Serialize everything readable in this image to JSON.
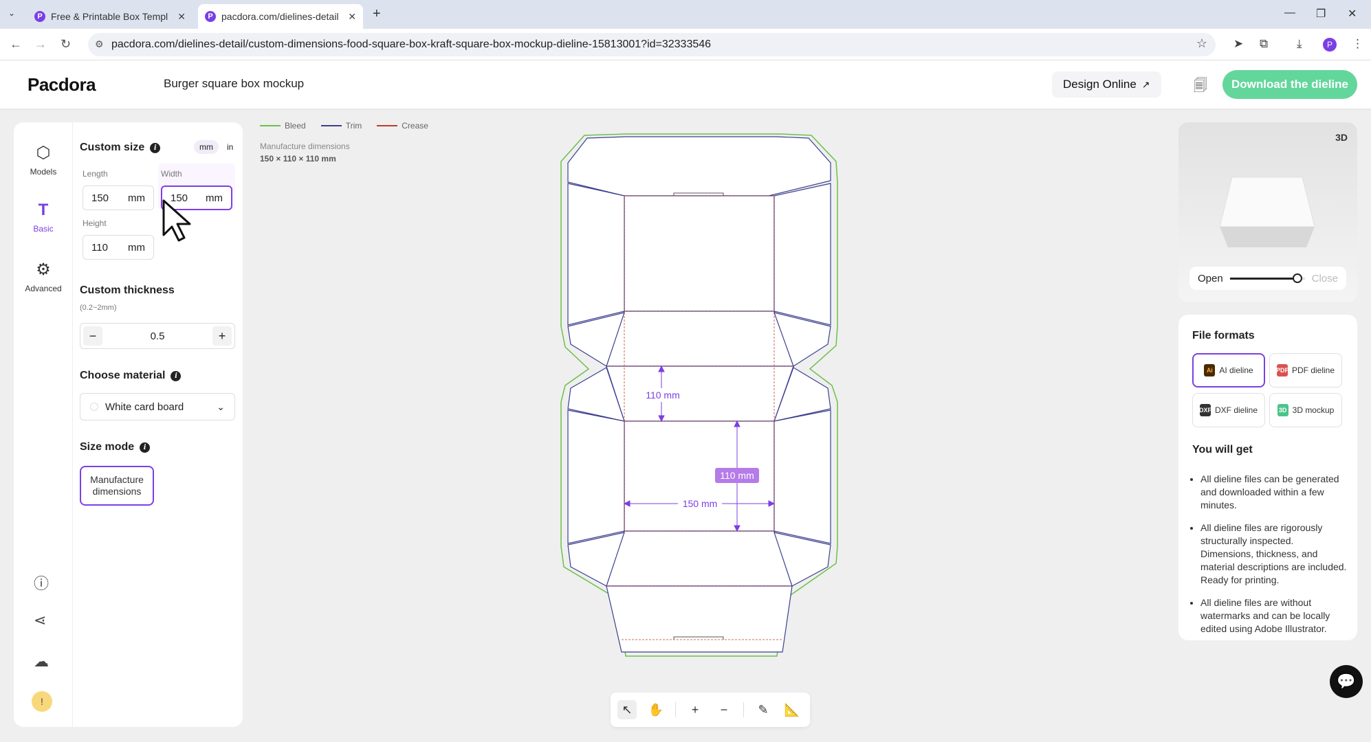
{
  "browser": {
    "tabs": [
      {
        "label": "Free & Printable Box Templat"
      },
      {
        "label": "pacdora.com/dielines-detail/"
      }
    ],
    "url": "paсdora.com/dielines-detail/custom-dimensions-food-square-box-kraft-square-box-mockup-dieline-15813001?id=32333546"
  },
  "header": {
    "logo": "Pacdora",
    "title": "Burger square box mockup",
    "design_online": "Design Online",
    "download": "Download the dieline"
  },
  "rail": {
    "items": [
      {
        "label": "Models",
        "icon": "cube-icon"
      },
      {
        "label": "Basic",
        "icon": "text-t-icon"
      },
      {
        "label": "Advanced",
        "icon": "sliders-icon"
      }
    ]
  },
  "custom_size": {
    "title": "Custom size",
    "units": [
      "mm",
      "in"
    ],
    "length_label": "Length",
    "length_value": "150",
    "width_label": "Width",
    "width_value": "150",
    "height_label": "Height",
    "height_value": "110",
    "unit": "mm"
  },
  "thickness": {
    "title": "Custom thickness",
    "range": "(0.2~2mm)",
    "value": "0.5",
    "minus": "−",
    "plus": "+"
  },
  "material": {
    "title": "Choose material",
    "value": "White card board"
  },
  "size_mode": {
    "title": "Size mode",
    "value": "Manufacture dimensions"
  },
  "legend": {
    "bleed": "Bleed",
    "trim": "Trim",
    "crease": "Crease",
    "colors": {
      "bleed": "#6cc04a",
      "trim": "#3b3f8f",
      "crease": "#c0392b"
    }
  },
  "manufacture": {
    "label": "Manufacture dimensions",
    "value": "150 × 110 × 110 mm"
  },
  "dims": {
    "top_height": "110 mm",
    "panel_height": "110 mm",
    "panel_width": "150 mm"
  },
  "preview": {
    "toggle": "3D",
    "open": "Open",
    "close": "Close",
    "level": 0.9
  },
  "file_formats": {
    "title": "File formats",
    "items": [
      {
        "label": "AI dieline",
        "badge": "Ai",
        "color": "#4a2a00"
      },
      {
        "label": "PDF dieline",
        "badge": "PDF",
        "color": "#d9534f"
      },
      {
        "label": "DXF dieline",
        "badge": "DXF",
        "color": "#333333"
      },
      {
        "label": "3D mockup",
        "badge": "3D",
        "color": "#4cc38a"
      }
    ],
    "you_will_get": "You will get",
    "benefits": [
      "All dieline files can be generated and downloaded within a few minutes.",
      "All dieline files are rigorously structurally inspected. Dimensions, thickness, and material descriptions are included. Ready for printing.",
      "All dieline files are without watermarks and can be locally edited using Adobe Illustrator."
    ]
  },
  "accent": "#7b3fe4"
}
